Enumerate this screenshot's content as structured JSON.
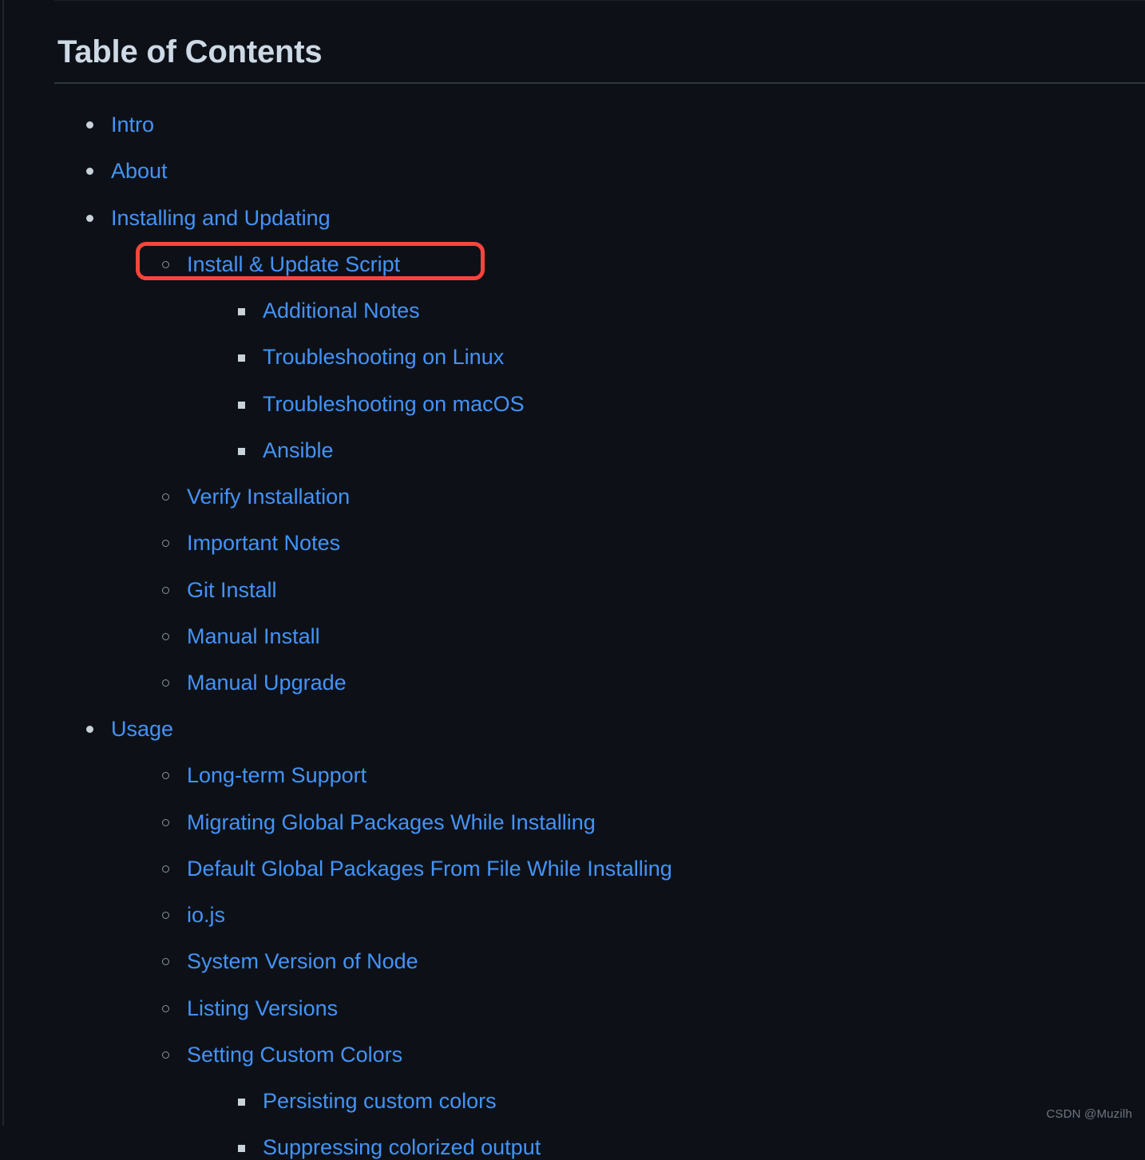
{
  "theme": {
    "background": "#0d1117",
    "link_color": "#4493f8",
    "heading_color": "#cdd9e5",
    "marker_color": "#c9d1d9",
    "rule_color": "#30363d",
    "highlight_color": "#f9453c"
  },
  "heading": {
    "title": "Table of Contents"
  },
  "toc": {
    "items": [
      {
        "label": "Intro",
        "level": 1
      },
      {
        "label": "About",
        "level": 1
      },
      {
        "label": "Installing and Updating",
        "level": 1,
        "children": [
          {
            "label": "Install & Update Script",
            "level": 2,
            "highlighted": true,
            "children": [
              {
                "label": "Additional Notes",
                "level": 3
              },
              {
                "label": "Troubleshooting on Linux",
                "level": 3
              },
              {
                "label": "Troubleshooting on macOS",
                "level": 3
              },
              {
                "label": "Ansible",
                "level": 3
              }
            ]
          },
          {
            "label": "Verify Installation",
            "level": 2
          },
          {
            "label": "Important Notes",
            "level": 2
          },
          {
            "label": "Git Install",
            "level": 2
          },
          {
            "label": "Manual Install",
            "level": 2
          },
          {
            "label": "Manual Upgrade",
            "level": 2
          }
        ]
      },
      {
        "label": "Usage",
        "level": 1,
        "children": [
          {
            "label": "Long-term Support",
            "level": 2
          },
          {
            "label": "Migrating Global Packages While Installing",
            "level": 2
          },
          {
            "label": "Default Global Packages From File While Installing",
            "level": 2
          },
          {
            "label": "io.js",
            "level": 2
          },
          {
            "label": "System Version of Node",
            "level": 2
          },
          {
            "label": "Listing Versions",
            "level": 2
          },
          {
            "label": "Setting Custom Colors",
            "level": 2,
            "children": [
              {
                "label": "Persisting custom colors",
                "level": 3
              },
              {
                "label": "Suppressing colorized output",
                "level": 3
              }
            ]
          }
        ]
      }
    ]
  },
  "watermark": {
    "text": "CSDN @Muzilh"
  }
}
